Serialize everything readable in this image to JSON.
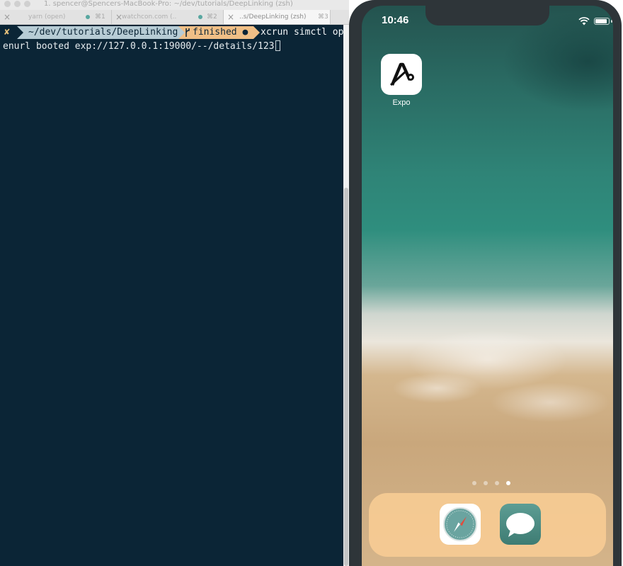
{
  "terminal": {
    "window_title": "1. spencer@Spencers-MacBook-Pro: ~/dev/tutorials/DeepLinking (zsh)",
    "tabs": [
      {
        "label": "yarn (open)",
        "shortcut": "⌘1",
        "active": false
      },
      {
        "label": "watchcon.com (..",
        "shortcut": "⌘2",
        "active": false
      },
      {
        "label": "..s/DeepLinking (zsh)",
        "shortcut": "⌘3",
        "active": true
      }
    ],
    "prompt": {
      "status_symbol": "✘",
      "path": "~/dev/tutorials/DeepLinking",
      "git_branch_icon": "branch-icon",
      "git_label": "finished ●",
      "command": "xcrun simctl op"
    },
    "output_line": "enurl booted exp://127.0.0.1:19000/--/details/123"
  },
  "simulator": {
    "status_time": "10:46",
    "apps": [
      {
        "label": "Expo",
        "icon": "expo-icon"
      }
    ],
    "page_dots_total": 4,
    "page_dots_current_index": 3,
    "dock_apps": [
      {
        "name": "Safari",
        "icon": "safari-icon"
      },
      {
        "name": "Messages",
        "icon": "messages-icon"
      }
    ],
    "battery_level": 0.9
  },
  "colors": {
    "terminal_bg": "#0b2536",
    "path_segment": "#b7ccd5",
    "git_segment": "#f0bf86",
    "dock": "#f6cb94"
  }
}
